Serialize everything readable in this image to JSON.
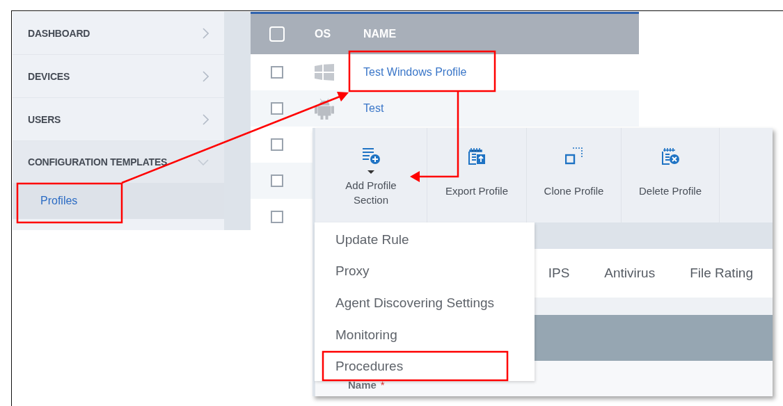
{
  "sidebar": {
    "items": [
      {
        "label": "DASHBOARD",
        "expanded": false
      },
      {
        "label": "DEVICES",
        "expanded": false
      },
      {
        "label": "USERS",
        "expanded": false
      },
      {
        "label": "CONFIGURATION TEMPLATES",
        "expanded": true,
        "children": [
          {
            "label": "Profiles",
            "selected": true
          }
        ]
      }
    ]
  },
  "table": {
    "header_checked": false,
    "columns": [
      "OS",
      "NAME"
    ],
    "rows": [
      {
        "checked": false,
        "kind": "windows",
        "name": "Test Windows Profile"
      },
      {
        "checked": false,
        "kind": "android",
        "name": "Test"
      },
      {
        "checked": false
      },
      {
        "checked": false
      },
      {
        "checked": false
      }
    ]
  },
  "toolbar": {
    "buttons": [
      {
        "label": "Add Profile Section",
        "has_menu": true
      },
      {
        "label": "Export Profile",
        "has_menu": false
      },
      {
        "label": "Clone Profile",
        "has_menu": false
      },
      {
        "label": "Delete Profile",
        "has_menu": false
      }
    ]
  },
  "section_menu": {
    "items": [
      "Update Rule",
      "Proxy",
      "Agent Discovering Settings",
      "Monitoring",
      "Procedures"
    ]
  },
  "tabs": [
    "IPS",
    "Antivirus",
    "File Rating"
  ],
  "form": {
    "fields": [
      {
        "label": "Name",
        "required_mark": "*"
      }
    ]
  }
}
